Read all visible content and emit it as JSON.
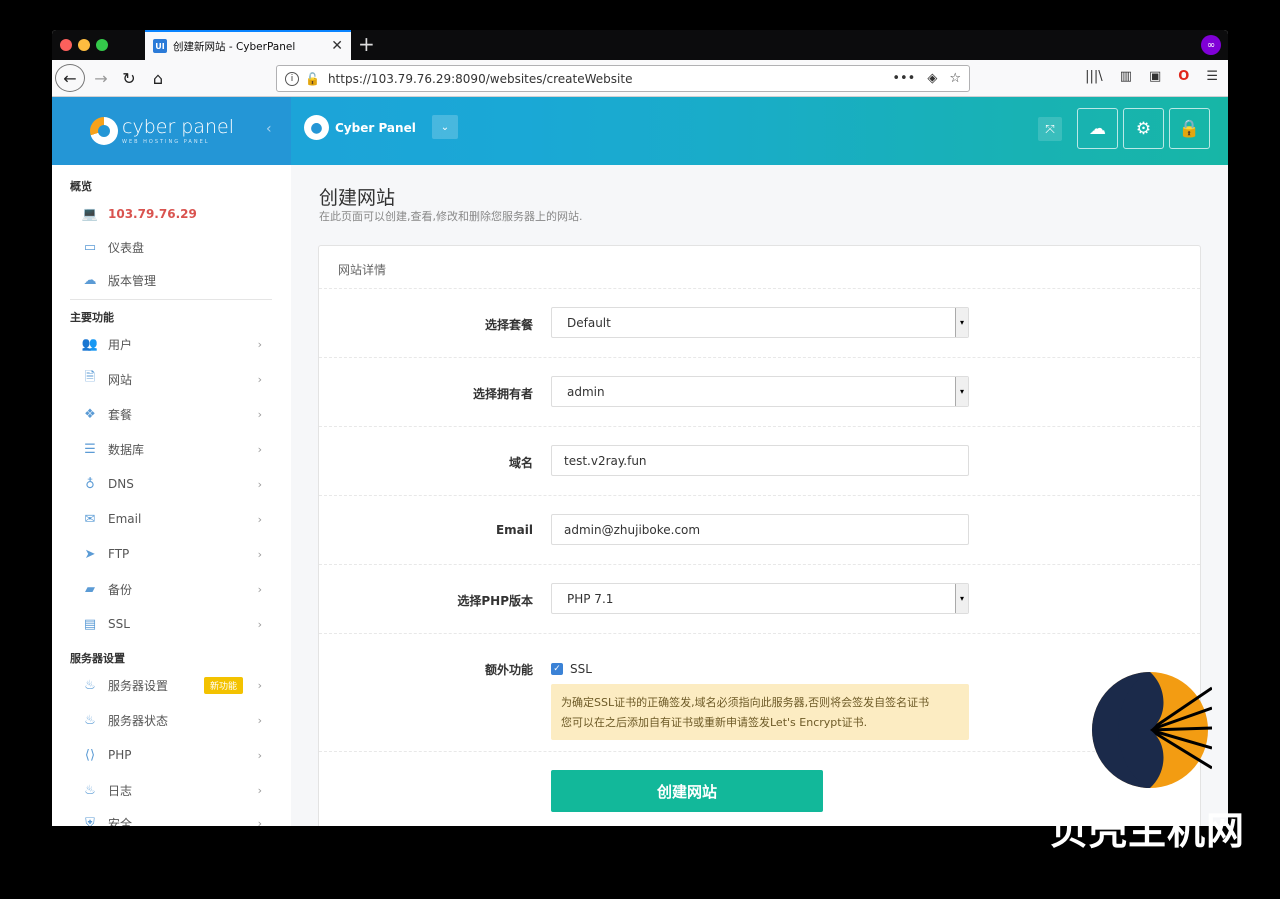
{
  "browser": {
    "tab_favicon": "UI",
    "tab_title": "创建新网站 - CyberPanel",
    "url": "https://103.79.76.29:8090/websites/createWebsite"
  },
  "header": {
    "logo_text": "cyber panel",
    "logo_sub": "WEB HOSTING PANEL",
    "user_name": "Cyber Panel"
  },
  "sidebar": {
    "overview_title": "概览",
    "ip_item": "103.79.76.29",
    "dashboard": "仪表盘",
    "version": "版本管理",
    "main_title": "主要功能",
    "items": [
      "用户",
      "网站",
      "套餐",
      "数据库",
      "DNS",
      "Email",
      "FTP",
      "备份",
      "SSL"
    ],
    "server_title": "服务器设置",
    "server_items": [
      "服务器设置",
      "服务器状态",
      "PHP",
      "日志",
      "安全"
    ],
    "new_badge": "新功能"
  },
  "main": {
    "title": "创建网站",
    "description": "在此页面可以创建,查看,修改和删除您服务器上的网站.",
    "panel_title": "网站详情",
    "labels": {
      "package": "选择套餐",
      "owner": "选择拥有者",
      "domain": "域名",
      "email": "Email",
      "php": "选择PHP版本",
      "extra": "额外功能"
    },
    "values": {
      "package": "Default",
      "owner": "admin",
      "domain": "test.v2ray.fun",
      "email": "admin@zhujiboke.com",
      "php": "PHP 7.1"
    },
    "ssl_label": "SSL",
    "ssl_note_line1": "为确定SSL证书的正确签发,域名必须指向此服务器,否则将会签发自签名证书",
    "ssl_note_line2": "您可以在之后添加自有证书或重新申请签发Let's Encrypt证书.",
    "submit": "创建网站"
  },
  "watermark": "贝壳主机网",
  "colors": {
    "accent": "#12b89a",
    "header_blue": "#2496d6",
    "ip_red": "#d9534f"
  }
}
